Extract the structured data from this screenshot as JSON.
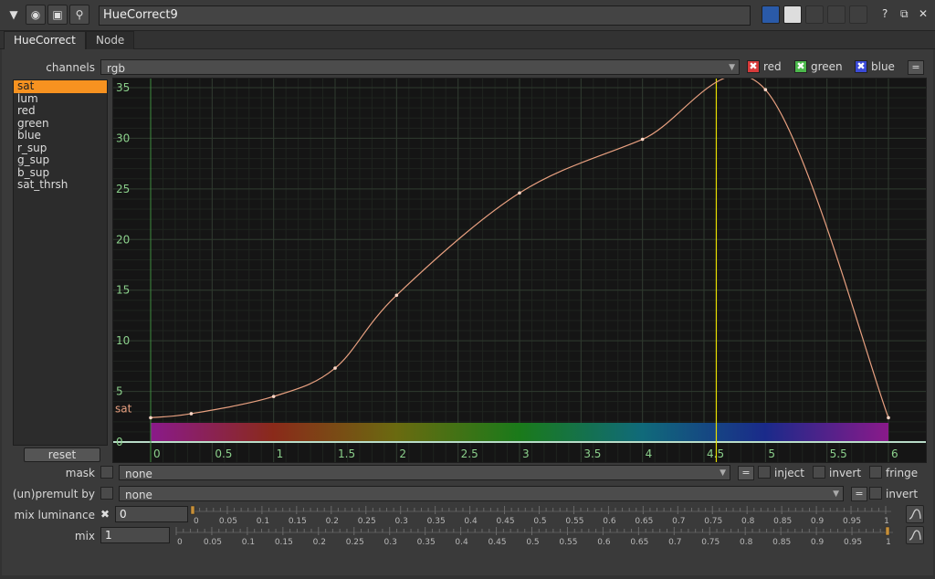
{
  "title_bar": {
    "node_name": "HueCorrect9",
    "icons": [
      "collapse-arrow-icon",
      "viewer-icon",
      "node-color-icon",
      "settings-icon"
    ],
    "right_icons": [
      "paste-icon",
      "copy-icon",
      "undo-icon",
      "redo-icon",
      "revert-icon",
      "help-icon",
      "float-icon",
      "close-icon"
    ],
    "help_label": "?",
    "float_label": "⧉",
    "close_label": "✕"
  },
  "tabs": [
    {
      "label": "HueCorrect",
      "active": true
    },
    {
      "label": "Node",
      "active": false
    }
  ],
  "channels": {
    "label": "channels",
    "value": "rgb",
    "toggles": [
      {
        "label": "red",
        "color": "#d83a3a"
      },
      {
        "label": "green",
        "color": "#4bb84b"
      },
      {
        "label": "blue",
        "color": "#3a4ad8"
      }
    ],
    "check_mark": "✖",
    "eq_label": "="
  },
  "curves": {
    "items": [
      "sat",
      "lum",
      "red",
      "green",
      "blue",
      "r_sup",
      "g_sup",
      "b_sup",
      "sat_thrsh"
    ],
    "selected": "sat",
    "reset_label": "reset"
  },
  "curve_editor": {
    "curve_label": "sat",
    "x_ticks": [
      "0",
      "0.5",
      "1",
      "1.5",
      "2",
      "2.5",
      "3",
      "3.5",
      "4",
      "4.5",
      "5",
      "5.5",
      "6"
    ],
    "y_ticks": [
      "0",
      "5",
      "10",
      "15",
      "20",
      "25",
      "30",
      "35"
    ],
    "xlim": [
      0,
      6
    ],
    "ylim": [
      0,
      35
    ],
    "cursor_x": 4.6,
    "curve_color": "#e8a080",
    "keyframes": [
      {
        "x": 0,
        "y": 2.4
      },
      {
        "x": 0.33,
        "y": 2.8
      },
      {
        "x": 1.0,
        "y": 4.5
      },
      {
        "x": 1.5,
        "y": 7.3
      },
      {
        "x": 2.0,
        "y": 14.5
      },
      {
        "x": 3.0,
        "y": 24.6
      },
      {
        "x": 4.0,
        "y": 29.9
      },
      {
        "x": 5.0,
        "y": 34.8
      },
      {
        "x": 6.0,
        "y": 2.4
      }
    ]
  },
  "mask": {
    "label": "mask",
    "value": "none",
    "eq_label": "=",
    "inject_label": "inject",
    "invert_label": "invert",
    "fringe_label": "fringe"
  },
  "unpremult": {
    "label": "(un)premult by",
    "value": "none",
    "eq_label": "=",
    "invert_label": "invert"
  },
  "mix_luminance": {
    "label": "mix luminance",
    "value": "0",
    "check_mark": "✖",
    "ticks": [
      "0",
      "0.05",
      "0.1",
      "0.15",
      "0.2",
      "0.25",
      "0.3",
      "0.35",
      "0.4",
      "0.45",
      "0.5",
      "0.55",
      "0.6",
      "0.65",
      "0.7",
      "0.75",
      "0.8",
      "0.85",
      "0.9",
      "0.95",
      "1"
    ],
    "level": 0
  },
  "mix": {
    "label": "mix",
    "value": "1",
    "ticks": [
      "0",
      "0.05",
      "0.1",
      "0.15",
      "0.2",
      "0.25",
      "0.3",
      "0.35",
      "0.4",
      "0.45",
      "0.5",
      "0.55",
      "0.6",
      "0.65",
      "0.7",
      "0.75",
      "0.8",
      "0.85",
      "0.9",
      "0.95",
      "1"
    ],
    "level": 1
  }
}
